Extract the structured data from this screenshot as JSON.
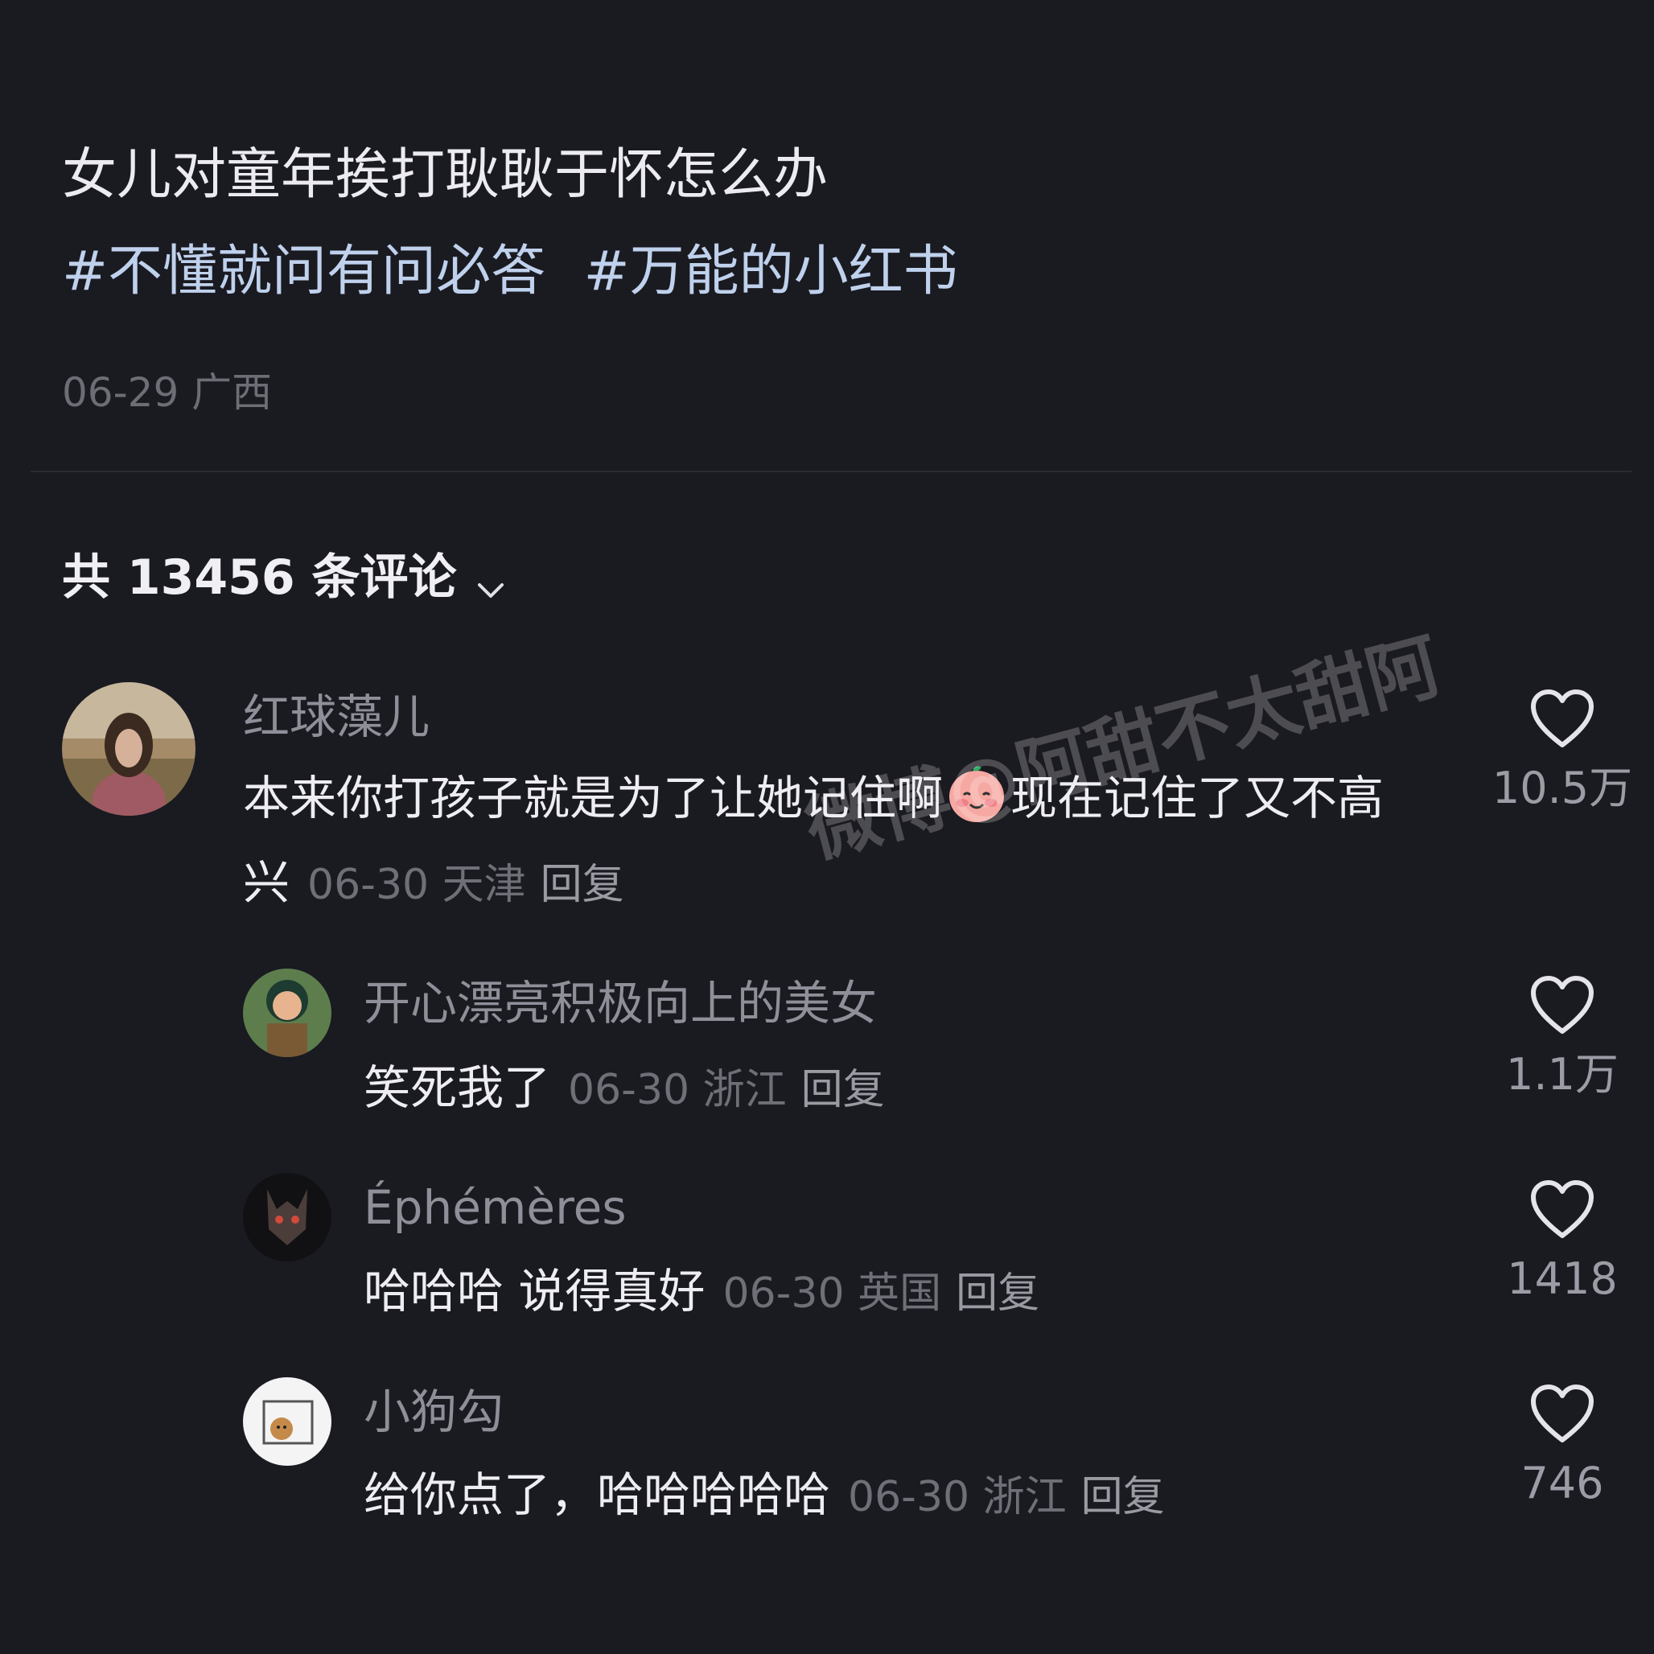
{
  "post": {
    "title": "女儿对童年挨打耿耿于怀怎么办",
    "tags": [
      "#不懂就问有问必答",
      "#万能的小红书"
    ],
    "meta": "06-29 广西"
  },
  "comments_header": {
    "label": "共 13456 条评论",
    "chevron_icon": "chevron-down-icon"
  },
  "comments": [
    {
      "username": "红球藻儿",
      "text_part1": "本来你打孩子就是为了让她记住啊",
      "emoji_icon": "smiling-face-emoji-icon",
      "text_part2": "现在记住了又不高兴",
      "meta": "06-30 天津",
      "reply_label": "回复",
      "likes": "10.5万",
      "like_icon": "heart-icon"
    },
    {
      "username": "开心漂亮积极向上的美女",
      "text": "笑死我了",
      "meta": "06-30 浙江",
      "reply_label": "回复",
      "likes": "1.1万",
      "like_icon": "heart-icon"
    },
    {
      "username": "Éphémères",
      "text": "哈哈哈 说得真好",
      "meta": "06-30 英国",
      "reply_label": "回复",
      "likes": "1418",
      "like_icon": "heart-icon"
    },
    {
      "username": "小狗勾",
      "text": "给你点了，哈哈哈哈哈",
      "meta": "06-30 浙江",
      "reply_label": "回复",
      "likes": "746",
      "like_icon": "heart-icon"
    }
  ],
  "watermark": "微博@阿甜不太甜阿",
  "colors": {
    "background": "#1a1a21",
    "tag_text": "#bfd1ec",
    "meta_text": "#6f6f78"
  }
}
